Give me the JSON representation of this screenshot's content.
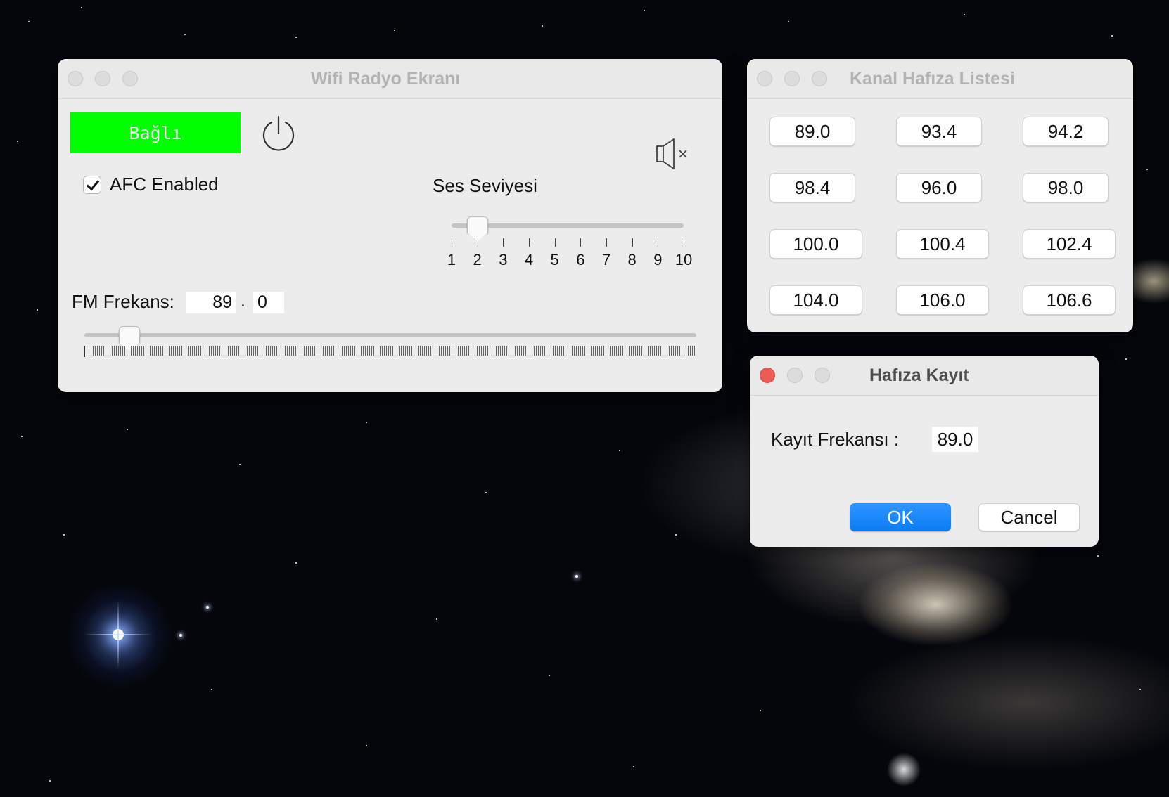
{
  "desktop": {
    "background": "starfield-galaxy"
  },
  "radio_window": {
    "title": "Wifi Radyo Ekranı",
    "status_button": {
      "label": "Bağlı",
      "color": "#00ff00"
    },
    "power_icon": "power-icon",
    "mute_icon": "speaker-muted-icon",
    "afc": {
      "label": "AFC Enabled",
      "checked": true
    },
    "volume": {
      "title": "Ses Seviyesi",
      "tick_labels": [
        "1",
        "2",
        "3",
        "4",
        "5",
        "6",
        "7",
        "8",
        "9",
        "10"
      ],
      "value": 2,
      "min": 1,
      "max": 10
    },
    "fm": {
      "label": "FM Frekans:",
      "integer": "89",
      "separator": ".",
      "decimal": "0",
      "slider_value": 89.0,
      "slider_min": 87.5,
      "slider_max": 108.0
    }
  },
  "channel_window": {
    "title": "Kanal Hafıza Listesi",
    "channels": [
      "89.0",
      "93.4",
      "94.2",
      "98.4",
      "96.0",
      "98.0",
      "100.0",
      "100.4",
      "102.4",
      "104.0",
      "106.0",
      "106.6"
    ]
  },
  "dialog": {
    "title": "Hafıza Kayıt",
    "label": "Kayıt Frekansı :",
    "value": "89.0",
    "ok_label": "OK",
    "cancel_label": "Cancel",
    "ok_color": "#0a7cf5"
  }
}
